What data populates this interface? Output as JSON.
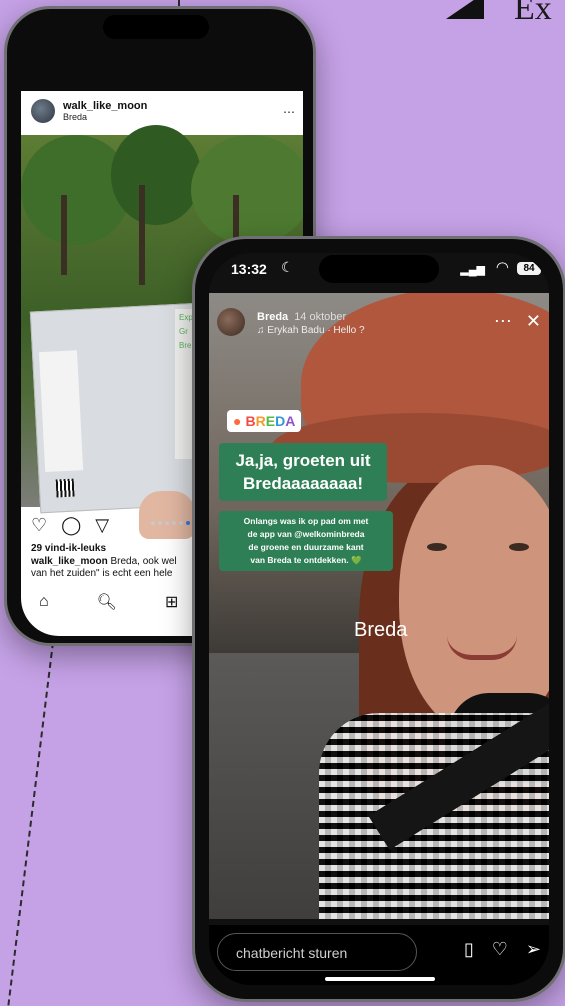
{
  "heading": {
    "text": "Ex"
  },
  "back_phone": {
    "post": {
      "username": "walk_like_moon",
      "location": "Breda",
      "more_icon": "more-dots-icon",
      "map_side_text": [
        "Exp",
        "Gr",
        "Bre"
      ],
      "likes": "29 vind-ik-leuks",
      "caption_user": "walk_like_moon",
      "caption_line1": "Breda, ook wel",
      "caption_line2": "van het zuiden\" is echt een hele",
      "action_icons": [
        "heart-icon",
        "comment-icon",
        "send-icon"
      ]
    },
    "nav_icons": [
      "home-icon",
      "search-icon",
      "create-icon"
    ]
  },
  "front_phone": {
    "status": {
      "time": "13:32",
      "battery": "84"
    },
    "story": {
      "username": "Breda",
      "date": "14 oktober",
      "music": "♫ Erykah Badu · Hello ?",
      "location_sticker_letters": [
        "B",
        "R",
        "E",
        "D",
        "A"
      ],
      "headline_line1": "Ja,ja, groeten uit",
      "headline_line2": "Bredaaaaaaaa!",
      "body_line1": "Onlangs was ik op pad om met",
      "body_line2": "de app van @welkominbreda",
      "body_line3": "de groene en duurzame kant",
      "body_line4": "van Breda te ontdekken. 💚",
      "location_text": "Breda"
    },
    "reply": {
      "placeholder": "chatbericht sturen",
      "icons": [
        "sticker-icon",
        "heart-icon",
        "send-icon"
      ]
    }
  },
  "colors": {
    "background": "#c5a1e6",
    "sticker_green": "#2e7f55",
    "hat": "#b0573d"
  }
}
